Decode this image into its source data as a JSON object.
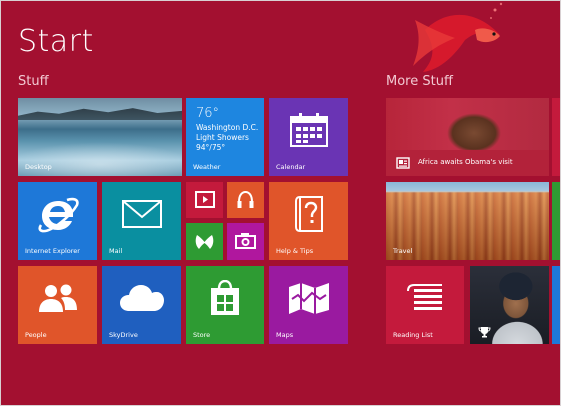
{
  "screen": {
    "title": "Start"
  },
  "groups": {
    "stuff": "Stuff",
    "more": "More Stuff"
  },
  "tiles": {
    "desktop": {
      "label": "Desktop"
    },
    "weather": {
      "label": "Weather",
      "temp": "76°",
      "city": "Washington D.C.",
      "condition": "Light Showers",
      "range": "94°/75°"
    },
    "calendar": {
      "label": "Calendar"
    },
    "internet_explorer": {
      "label": "Internet Explorer"
    },
    "mail": {
      "label": "Mail"
    },
    "help": {
      "label": "Help & Tips"
    },
    "people": {
      "label": "People"
    },
    "skydrive": {
      "label": "SkyDrive"
    },
    "store": {
      "label": "Store"
    },
    "maps": {
      "label": "Maps"
    },
    "news": {
      "headline": "Africa awaits Obama's visit"
    },
    "travel": {
      "label": "Travel"
    },
    "reading_list": {
      "label": "Reading List"
    }
  },
  "colors": {
    "background": "#a31030",
    "ie_blue": "#1e78d8",
    "mail_teal": "#0a8fa0",
    "calendar_purple": "#6a34b4",
    "help_orange": "#e0552a",
    "people_orange": "#e0552a",
    "skydrive_blue": "#1f5fbf",
    "store_green": "#2e9b33",
    "maps_purple": "#9a1aa0",
    "reading_red": "#c41a3c"
  },
  "icons": {
    "video": "video-icon",
    "music": "headphones-icon",
    "games": "xbox-controller-icon",
    "camera": "camera-icon",
    "ie": "internet-explorer-icon",
    "mail": "mail-envelope-icon",
    "calendar": "calendar-grid-icon",
    "help": "help-question-icon",
    "people": "people-icon",
    "skydrive": "cloud-icon",
    "store": "store-bag-icon",
    "maps": "maps-icon",
    "reading": "reading-list-icon",
    "trophy": "trophy-icon",
    "news": "news-icon"
  }
}
